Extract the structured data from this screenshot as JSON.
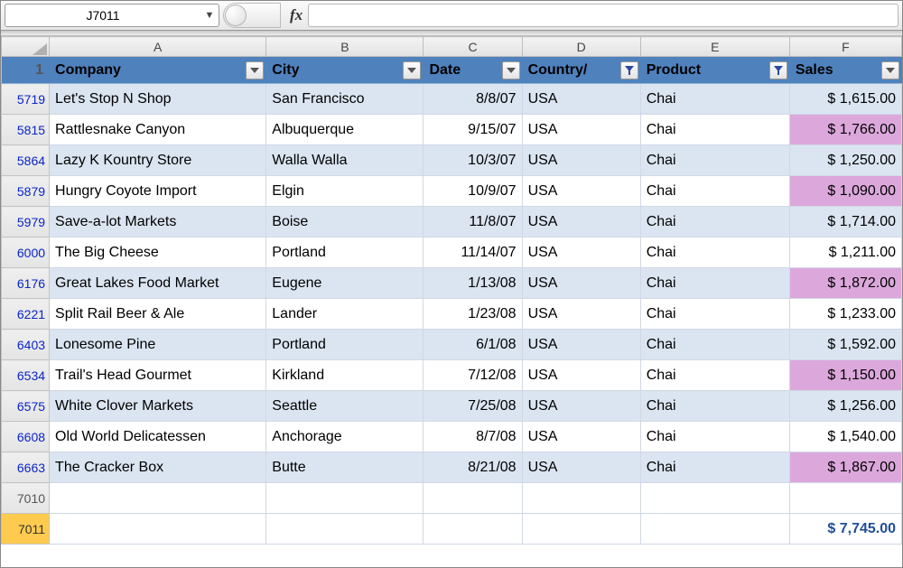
{
  "name_box": {
    "value": "J7011"
  },
  "fx_label": "fx",
  "formula": {
    "value": ""
  },
  "col_headers": [
    "A",
    "B",
    "C",
    "D",
    "E",
    "F"
  ],
  "table_headers": [
    {
      "label": "Company",
      "filtered": false
    },
    {
      "label": "City",
      "filtered": false
    },
    {
      "label": "Date",
      "filtered": false
    },
    {
      "label": "Country/",
      "filtered": true
    },
    {
      "label": "Product",
      "filtered": true
    },
    {
      "label": "Sales",
      "filtered": false
    }
  ],
  "rows": [
    {
      "n": "5719",
      "band": 0,
      "company": "Let's Stop N Shop",
      "city": "San Francisco",
      "date": "8/8/07",
      "country": "USA",
      "product": "Chai",
      "sales": "$  1,615.00",
      "hl": false
    },
    {
      "n": "5815",
      "band": 1,
      "company": "Rattlesnake Canyon",
      "city": "Albuquerque",
      "date": "9/15/07",
      "country": "USA",
      "product": "Chai",
      "sales": "$  1,766.00",
      "hl": true
    },
    {
      "n": "5864",
      "band": 0,
      "company": "Lazy K Kountry Store",
      "city": "Walla Walla",
      "date": "10/3/07",
      "country": "USA",
      "product": "Chai",
      "sales": "$  1,250.00",
      "hl": false
    },
    {
      "n": "5879",
      "band": 1,
      "company": "Hungry Coyote Import",
      "city": "Elgin",
      "date": "10/9/07",
      "country": "USA",
      "product": "Chai",
      "sales": "$  1,090.00",
      "hl": true
    },
    {
      "n": "5979",
      "band": 0,
      "company": "Save-a-lot Markets",
      "city": "Boise",
      "date": "11/8/07",
      "country": "USA",
      "product": "Chai",
      "sales": "$  1,714.00",
      "hl": false
    },
    {
      "n": "6000",
      "band": 1,
      "company": "The Big Cheese",
      "city": "Portland",
      "date": "11/14/07",
      "country": "USA",
      "product": "Chai",
      "sales": "$  1,211.00",
      "hl": false
    },
    {
      "n": "6176",
      "band": 0,
      "company": "Great Lakes Food Market",
      "city": "Eugene",
      "date": "1/13/08",
      "country": "USA",
      "product": "Chai",
      "sales": "$  1,872.00",
      "hl": true
    },
    {
      "n": "6221",
      "band": 1,
      "company": "Split Rail Beer & Ale",
      "city": "Lander",
      "date": "1/23/08",
      "country": "USA",
      "product": "Chai",
      "sales": "$  1,233.00",
      "hl": false
    },
    {
      "n": "6403",
      "band": 0,
      "company": "Lonesome Pine",
      "city": "Portland",
      "date": "6/1/08",
      "country": "USA",
      "product": "Chai",
      "sales": "$  1,592.00",
      "hl": false
    },
    {
      "n": "6534",
      "band": 1,
      "company": "Trail's Head Gourmet",
      "city": "Kirkland",
      "date": "7/12/08",
      "country": "USA",
      "product": "Chai",
      "sales": "$  1,150.00",
      "hl": true
    },
    {
      "n": "6575",
      "band": 0,
      "company": "White Clover Markets",
      "city": "Seattle",
      "date": "7/25/08",
      "country": "USA",
      "product": "Chai",
      "sales": "$  1,256.00",
      "hl": false
    },
    {
      "n": "6608",
      "band": 1,
      "company": "Old World Delicatessen",
      "city": "Anchorage",
      "date": "8/7/08",
      "country": "USA",
      "product": "Chai",
      "sales": "$  1,540.00",
      "hl": false
    },
    {
      "n": "6663",
      "band": 0,
      "company": "The Cracker Box",
      "city": "Butte",
      "date": "8/21/08",
      "country": "USA",
      "product": "Chai",
      "sales": "$  1,867.00",
      "hl": true
    }
  ],
  "blank_row": {
    "n": "7010"
  },
  "total_row": {
    "n": "7011",
    "sales": "$  7,745.00"
  }
}
